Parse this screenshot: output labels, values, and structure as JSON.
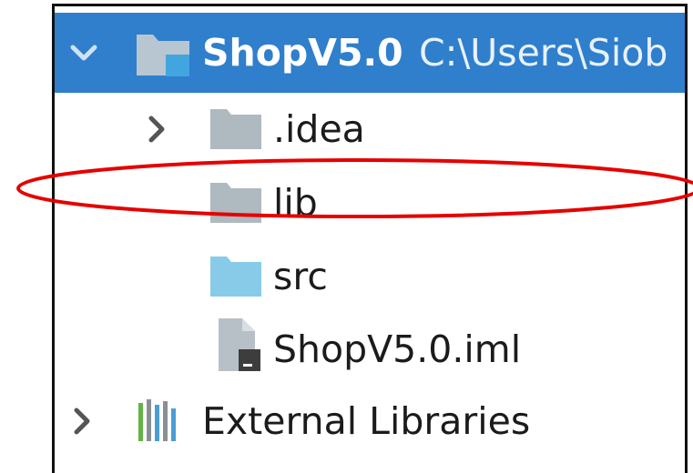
{
  "tree": {
    "root": {
      "name": "ShopV5.0",
      "path": "C:\\Users\\Siob",
      "expanded": true,
      "icon": "module-folder-icon"
    },
    "items": [
      {
        "label": ".idea",
        "icon": "folder-icon",
        "collapsed": true
      },
      {
        "label": "lib",
        "icon": "folder-icon"
      },
      {
        "label": "src",
        "icon": "source-folder-icon"
      },
      {
        "label": "ShopV5.0.iml",
        "icon": "iml-file-icon"
      }
    ],
    "external": {
      "label": "External Libraries",
      "icon": "libraries-icon",
      "collapsed": true
    }
  },
  "colors": {
    "selection": "#2f7fcc",
    "folder": "#aeb9c0",
    "source_folder": "#87cbe8",
    "annotation": "#e60000"
  }
}
